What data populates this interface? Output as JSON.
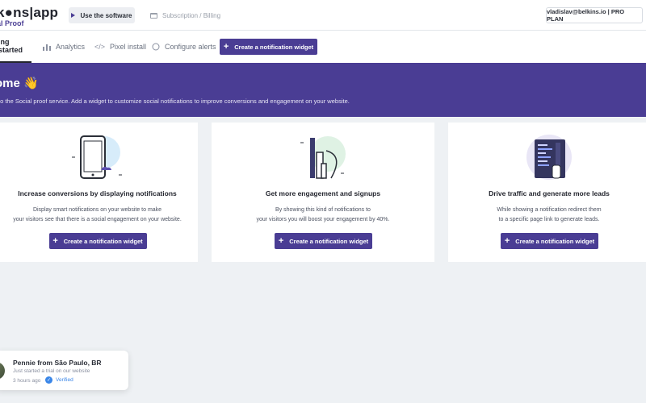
{
  "header": {
    "logo_text": "k●ns|app",
    "logo_sub": "al Proof",
    "use_software_label": "Use the software",
    "subscription_label": "Subscription / Billing",
    "user_label": "vladislav@belkins.io | PRO PLAN"
  },
  "tabs": [
    {
      "label": "ing started",
      "icon": ""
    },
    {
      "label": "Analytics",
      "icon": "bar-chart-icon"
    },
    {
      "label": "Pixel install",
      "icon": "code-icon"
    },
    {
      "label": "Configure alerts",
      "icon": "chat-bubble-icon"
    }
  ],
  "tab_create_label": "Create a notification widget",
  "banner": {
    "title": "ome 👋",
    "text": "to the Social proof service. Add a widget to customize social notifications to improve conversions and engagement on your website."
  },
  "cards": [
    {
      "title": "Increase conversions by displaying notifications",
      "desc_line1": "Display smart notifications on your website to make",
      "desc_line2": "your visitors see that there is a social engagement on your website.",
      "button": "Create a notification widget"
    },
    {
      "title": "Get more engagement and signups",
      "desc_line1": "By showing this kind of notifications to",
      "desc_line2": "your visitors you will boost your engagement by 40%.",
      "button": "Create a notification widget"
    },
    {
      "title": "Drive traffic and generate more leads",
      "desc_line1": "While showing a notification redirect them",
      "desc_line2": "to a specific page link to generate leads.",
      "button": "Create a notification widget"
    }
  ],
  "toast": {
    "name": "Pennie from São Paulo, BR",
    "message": "Just started a trial on our website",
    "time": "3 hours ago",
    "verified": "Verified"
  },
  "colors": {
    "accent": "#4a3d94",
    "background": "#eef1f4",
    "verified_blue": "#3a86e8"
  }
}
